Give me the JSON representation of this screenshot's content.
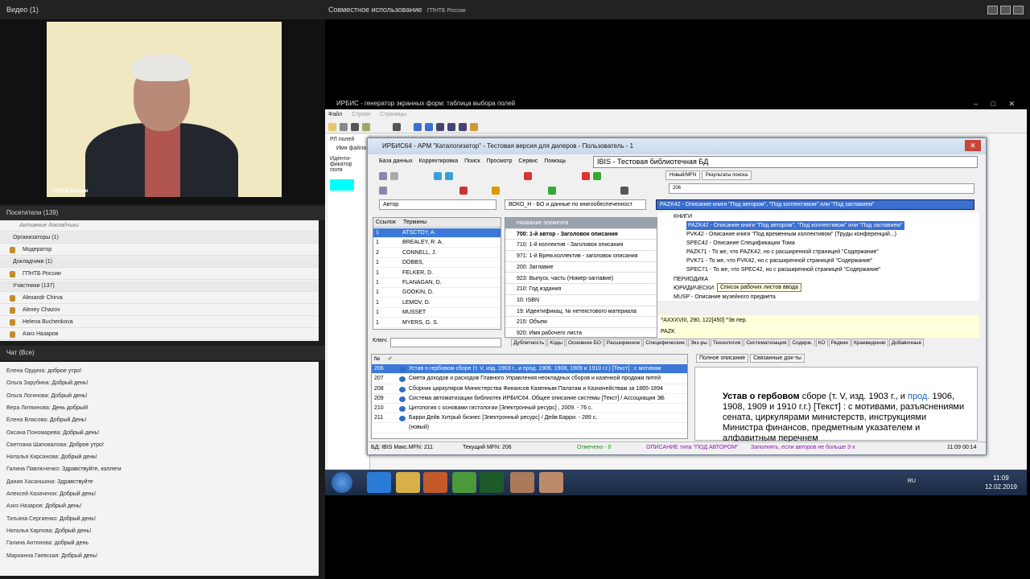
{
  "left_panel": {
    "video_title": "Видео",
    "video_count": "(1)",
    "camera_label": "ГПНТБ России",
    "attendees_title": "Посетители",
    "attendees_count": "(139)",
    "attendees_filter": "Активные докладчики",
    "groups": [
      {
        "label": "Организаторы (1)",
        "members": [
          "Модератор"
        ]
      },
      {
        "label": "Докладчики (1)",
        "members": [
          "ГПНТБ России"
        ]
      },
      {
        "label": "Участники (137)",
        "members": [
          "Alexandr Chirva",
          "Alexey Chazov",
          "Helena Buchenkova",
          "Азиз Назаров"
        ]
      }
    ],
    "chat_title": "Чат",
    "chat_scope": "(Все)",
    "chat": [
      {
        "who": "Елена Ордина",
        "msg": "доброе утро!"
      },
      {
        "who": "Ольга Зарубина",
        "msg": "Добрый день!"
      },
      {
        "who": "Ольга Логинова",
        "msg": "Добрый день!"
      },
      {
        "who": "Вера Литвинова",
        "msg": "День добрый!"
      },
      {
        "who": "Елена Власова",
        "msg": "Добрый День!"
      },
      {
        "who": "Оксана Пономарева",
        "msg": "Добрый день!"
      },
      {
        "who": "Светлана Шаповалова",
        "msg": "Доброе утро!"
      },
      {
        "who": "Наталья  Кирсанова",
        "msg": "Добрый день!"
      },
      {
        "who": "Галина Павлюченко",
        "msg": "Здравствуйте, коллеги"
      },
      {
        "who": "Дания Хасаншина",
        "msg": "Здравствуйте"
      },
      {
        "who": "Алексей Казаченок",
        "msg": "Добрый день!"
      },
      {
        "who": "Азиз Назаров",
        "msg": "Добрый день!"
      },
      {
        "who": "Татьяна Сергиенко",
        "msg": "Добрый день!"
      },
      {
        "who": "Наталья Карпова",
        "msg": "Добрый день!"
      },
      {
        "who": "Галина Антонова",
        "msg": "добрый день"
      },
      {
        "who": "Марианна Гаевская",
        "msg": "Добрый день!"
      }
    ]
  },
  "share": {
    "title": "Совместное использование",
    "presenter": "ГПНТБ России"
  },
  "generator": {
    "title": "ИРБИС - генератор экранных форм: таблица выбора полей",
    "menu": [
      "Файл",
      "Строки",
      "Страницы"
    ],
    "side_items": [
      "РЛ полей",
      "Имя файла",
      "Иденти-фикатор поля"
    ]
  },
  "irbis": {
    "title": "ИРБИС64 - АРМ \"Каталогизатор\" - Тестовая версия для дилеров - Пользователь - 1",
    "menu": [
      "База данных",
      "Корректировка",
      "Поиск",
      "Просмотр",
      "Сервис",
      "Помощь"
    ],
    "database": "IBIS - Тестовая библиотечная БД",
    "tabs_top": [
      "Новый/MFN",
      "Результаты поиска"
    ],
    "mfn_value": "206",
    "search_field": "Автор",
    "format": "ВОКО_Н - БО и данные по книгообеспеченност",
    "worksheet": "PAZK42 - Описание книги \"Под автором\", \"Под коллективом\" или \"Под заглавием\"",
    "terms_headers": [
      "Ссылок",
      "Термины"
    ],
    "terms": [
      {
        "count": "1",
        "term": "ATSCTOY, A."
      },
      {
        "count": "1",
        "term": "BREALEY, R. A."
      },
      {
        "count": "2",
        "term": "CONNELL, J."
      },
      {
        "count": "1",
        "term": "DOBBS,"
      },
      {
        "count": "1",
        "term": "FELKER, D."
      },
      {
        "count": "1",
        "term": "FLANAGAN, D."
      },
      {
        "count": "1",
        "term": "GOOKIN, D."
      },
      {
        "count": "1",
        "term": "LEMOV, D."
      },
      {
        "count": "1",
        "term": "MUSSET"
      },
      {
        "count": "1",
        "term": "MYERS, G. S."
      }
    ],
    "key_label": "Ключ:",
    "elements_header": "Название элемента",
    "elements": [
      {
        "label": "700: 1-й автор - Заголовок описания",
        "bold": true
      },
      {
        "label": "710: 1-й коллектив - Заголовок описания",
        "bold": false
      },
      {
        "label": "971: 1-й Врем.коллектив - заголовок описания",
        "bold": false
      },
      {
        "label": "200: Заглавие",
        "bold": false
      },
      {
        "label": "923: Выпуск, часть (Номер-заглавие)",
        "bold": false
      },
      {
        "label": "210: Год издания",
        "bold": false
      },
      {
        "label": "10: ISBN",
        "bold": false
      },
      {
        "label": "19: Идентификац. № нетекстового материала",
        "bold": false
      },
      {
        "label": "215: Объем",
        "bold": false
      },
      {
        "label": "920: Имя рабочего листа",
        "bold": false
      }
    ],
    "tree_root": "КНИГИ",
    "tree": [
      {
        "label": "PAZK42 - Описание книги \"Под автором\", \"Под коллективом\" или \"Под заглавием\"",
        "active": true
      },
      {
        "label": "PVK42 - Описание книги \"Под временным коллективом\" (Труды конференций...)",
        "active": false
      },
      {
        "label": "SPEC42 - Описание Спецификации Тома",
        "active": false
      },
      {
        "label": "PAZK71 - То же, что PAZK42, но с расширенной страницей \"Содержание\"",
        "active": false
      },
      {
        "label": "PVK71 - То же, что PVK42, но с расширенной страницей \"Содержание\"",
        "active": false
      },
      {
        "label": "SPEC71 - То же, что SPEC42, но с расширенной страницей \"Содержание\"",
        "active": false
      }
    ],
    "tree_more": [
      "ПЕРИОДИКА",
      "ЮРИДИЧЕСКИ",
      "MUSP - Описание музейного предмета"
    ],
    "tooltip": "Список рабочих листов ввода",
    "values": [
      "^AXXXVIII, 290, 122[450] ^3в пер.",
      "PAZK"
    ],
    "tabs_bottom": [
      "Дублетность",
      "Коды",
      "Основное БО",
      "Расширенное",
      "Специфические",
      "Экз-ры",
      "Технология",
      "Систематизация",
      "Содерж.",
      "КО",
      "Редкие",
      "Краеведение",
      "Добавочные"
    ],
    "list_header": "№",
    "list": [
      {
        "n": "206",
        "text": "Устав о гербовом сборе (т. V, изд. 1903 г., и прод. 1906, 1908, 1909 и 1910 г.г.) [Текст] : с мотивам",
        "active": true
      },
      {
        "n": "207",
        "text": "Смета доходов и расходов Главного Управления неокладных сборов и казенной продажи питей",
        "active": false
      },
      {
        "n": "208",
        "text": "Сборник циркуляров Министерства Финансов Казенным Палатам и Казначействам за 1865-1894",
        "active": false
      },
      {
        "n": "209",
        "text": "Система автоматизации библиотек ИРБИС64. Общее описание системы [Текст] / Ассоциация ЭБ",
        "active": false
      },
      {
        "n": "210",
        "text": "Цитология с основами гистологии [Электронный ресурс] , 2009. - 76 с.",
        "active": false
      },
      {
        "n": "211",
        "text": "Барри Дейв Хитрый бизнес [Электронный ресурс]  / Дейв Барри. - 289 с.",
        "active": false
      },
      {
        "n": "",
        "text": "(новый)",
        "active": false
      }
    ],
    "desc_tabs": [
      "Полное описание",
      "Связанные док-ты"
    ],
    "desc_bold": "Устав о гербовом",
    "desc_part1": " сборе (т. V, изд. 1903 г., и ",
    "desc_hl": "прод.",
    "desc_part2": " 1906, 1908, 1909 и 1910 г.г.) [Текст] : с мотивами, разъяснениями сената, циркулярами министерств, инструкциями Министра финансов, предметным указателем и алфавитным перечнем",
    "status": {
      "db": "БД: IBIS Макс.MFN: 211",
      "current": "Текущий MFN: 206",
      "marked": "Отмечено - 0",
      "desc_type": "ОПИСАНИЕ типа \"ПОД АВТОРОМ\"",
      "hint": "Заполнять, если авторов не больше 3-х",
      "time": "11:09  00:14"
    }
  },
  "taskbar": {
    "lang": "RU",
    "time": "11:09",
    "date": "12.02.2019"
  }
}
